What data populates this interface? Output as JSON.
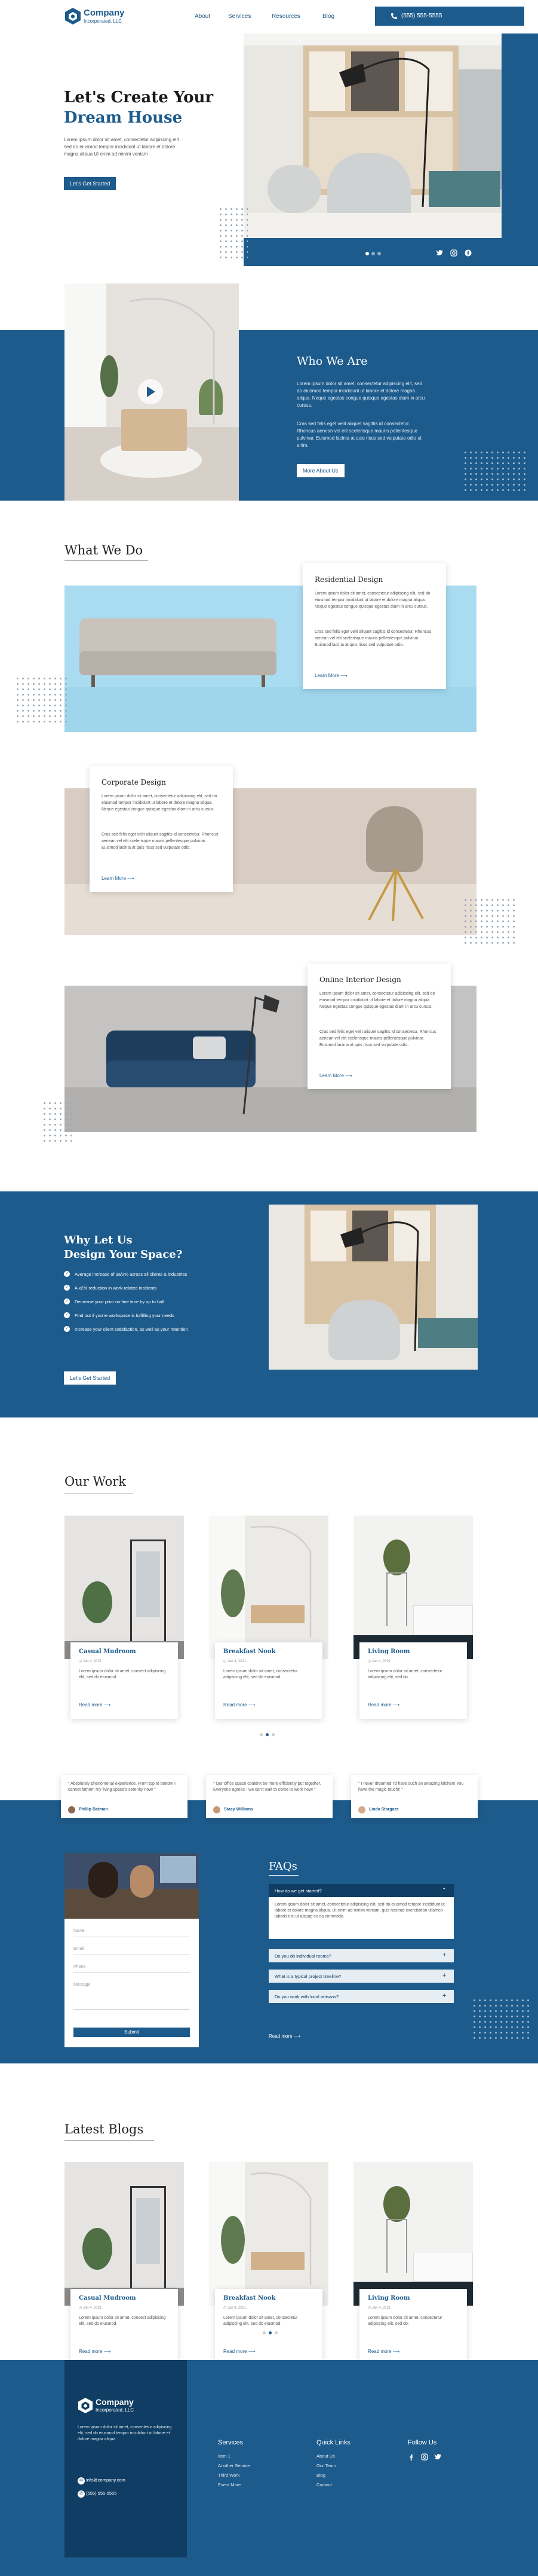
{
  "brand": {
    "name": "Company",
    "sub": "Incorporated, LLC",
    "phone": "(555) 555-5555"
  },
  "nav": {
    "about": "About",
    "services": "Services",
    "resources": "Resources",
    "blog": "Blog"
  },
  "hero": {
    "title1": "Let's Create Your",
    "title2": "Dream House",
    "text": "Lorem ipsum dolor sit amet, consectetur adipiscing elit sed do eiusmod tempor incididunt ut labore et dolore magna aliqua Ut enim ad minim veniam",
    "cta": "Let's Get Started"
  },
  "who": {
    "title": "Who We Are",
    "p1": "Lorem ipsum dolor sit amet, consectetur adipiscing elit, sed do eiusmod tempor incididunt ut labore et dolore magna aliqua. Neque egestas congue quisque egestas diam in arcu cursus.",
    "p2": "Cras sed felis eget velit aliquet sagittis id consectetur. Rhoncus aenean vel elit scelerisque mauris pellentesque pulvinar. Euismod lacinia at quis risus sed vulputate odio ut enim.",
    "cta": "More About Us"
  },
  "what": {
    "title": "What We Do",
    "items": [
      {
        "title": "Residential Design",
        "p1": "Lorem ipsum dolor sit amet, consectetur adipiscing elit, sed do eiusmod tempor incididunt ut labore et dolore magna aliqua. Neque egestas congue quisque egestas diam in arcu cursus.",
        "p2": "Cras sed felis eget velit aliquet sagittis id consectetur. Rhoncus aenean vel elit scelerisque mauris pellentesque pulvinar. Euismod lacinia at quis risus sed vulputate odio.",
        "link": "Learn More"
      },
      {
        "title": "Corporate Design",
        "p1": "Lorem ipsum dolor sit amet, consectetur adipiscing elit, sed do eiusmod tempor incididunt ut labore et dolore magna aliqua. Neque egestas congue quisque egestas diam in arcu cursus.",
        "p2": "Cras sed felis eget velit aliquet sagittis id consectetur. Rhoncus aenean vel elit scelerisque mauris pellentesque pulvinar. Euismod lacinia at quis risus sed vulputate odio.",
        "link": "Learn More"
      },
      {
        "title": "Online Interior Design",
        "p1": "Lorem ipsum dolor sit amet, consectetur adipiscing elit, sed do eiusmod tempor incididunt ut labore et dolore magna aliqua. Neque egestas congue quisque egestas diam in arcu cursus.",
        "p2": "Cras sed felis eget velit aliquet sagittis id consectetur. Rhoncus aenean vel elit scelerisque mauris pellentesque pulvinar. Euismod lacinia at quis risus sed vulputate odio.",
        "link": "Learn More"
      }
    ]
  },
  "why": {
    "title1": "Why Let Us",
    "title2": "Design Your Space?",
    "points": [
      "Average increase of 3a/2% across all clients & industries",
      "A x2% reduction in work-related incidents",
      "Decrease your prior no-fine time by up to half",
      "Find out if you're workspace is fulfilling your needs",
      "Increase your client satisfaction, as well as your retention"
    ],
    "cta": "Let's Get Started"
  },
  "work": {
    "title": "Our Work",
    "items": [
      {
        "title": "Casual Mudroom",
        "date": "Jan 4, 2021",
        "text": "Lorem ipsum dolor sit amet, consect adipiscing elit, sed do eiusmod.",
        "link": "Read more"
      },
      {
        "title": "Breakfast Nook",
        "date": "Jan 4, 2021",
        "text": "Lorem ipsum dolor sit amet, consectetur adipiscing elit, sed do eiusmod.",
        "link": "Read more"
      },
      {
        "title": "Living Room",
        "date": "Jan 4, 2021",
        "text": "Lorem ipsum dolor sit amet, consectetur adipiscing elit, sed do.",
        "link": "Read more"
      }
    ]
  },
  "testimonials": [
    {
      "quote": "\" Absolutely phenomenal experience. From top to bottom I cannot fathom my living space's serenity now! \"",
      "name": "Phillip Batman"
    },
    {
      "quote": "\" Our office space couldn't be more efficiently put together. Everyone agrees - we can't wait to come to work now! \"",
      "name": "Stacy Williams"
    },
    {
      "quote": "\" I never dreamed I'd have such an amazing kitchen! You have the magic touch!! \"",
      "name": "Linda Stargaze"
    }
  ],
  "form": {
    "name": "Name",
    "email": "Email",
    "phone": "Phone",
    "message": "Message",
    "submit": "Submit"
  },
  "faq": {
    "title": "FAQs",
    "open_q": "How do we get started?",
    "open_a": "Lorem ipsum dolor sit amet, consectetur adipiscing elit, sed do eiusmod tempor incididunt ut labore et dolore magna aliqua. Ut enim ad minim veniam, quis nostrud exercitation ullamco laboris nisi ut aliquip ex ea commodo.",
    "q2": "Do you do individual rooms?",
    "q3": "What is a typical project timeline?",
    "q4": "Do you work with local artisans?",
    "link": "Read more"
  },
  "blogs": {
    "title": "Latest Blogs",
    "items": [
      {
        "title": "Casual Mudroom",
        "date": "Jan 4, 2021",
        "text": "Lorem ipsum dolor sit amet, consect adipiscing elit, sed do eiusmod.",
        "link": "Read more"
      },
      {
        "title": "Breakfast Nook",
        "date": "Jan 4, 2021",
        "text": "Lorem ipsum dolor sit amet, consectetur adipiscing elit, sed do eiusmod.",
        "link": "Read more"
      },
      {
        "title": "Living Room",
        "date": "Jan 4, 2021",
        "text": "Lorem ipsum dolor sit amet, consectetur adipiscing elit, sed do.",
        "link": "Read more"
      }
    ]
  },
  "footer": {
    "text": "Lorem ipsum dolor sit amet, consectetur adipiscing elit, sed do eiusmod tempor incididunt ut labore et dolore magna aliqua.",
    "email": "info@company.com",
    "phone": "(555) 555-5555",
    "services_title": "Services",
    "services": [
      "Item 1",
      "Another Service",
      "Third Work",
      "Event More"
    ],
    "links_title": "Quick Links",
    "links": [
      "About Us",
      "Our Team",
      "Blog",
      "Contact"
    ],
    "follow_title": "Follow Us"
  },
  "colors": {
    "primary": "#1d5b8c",
    "light_blue": "#a9dcf0"
  }
}
